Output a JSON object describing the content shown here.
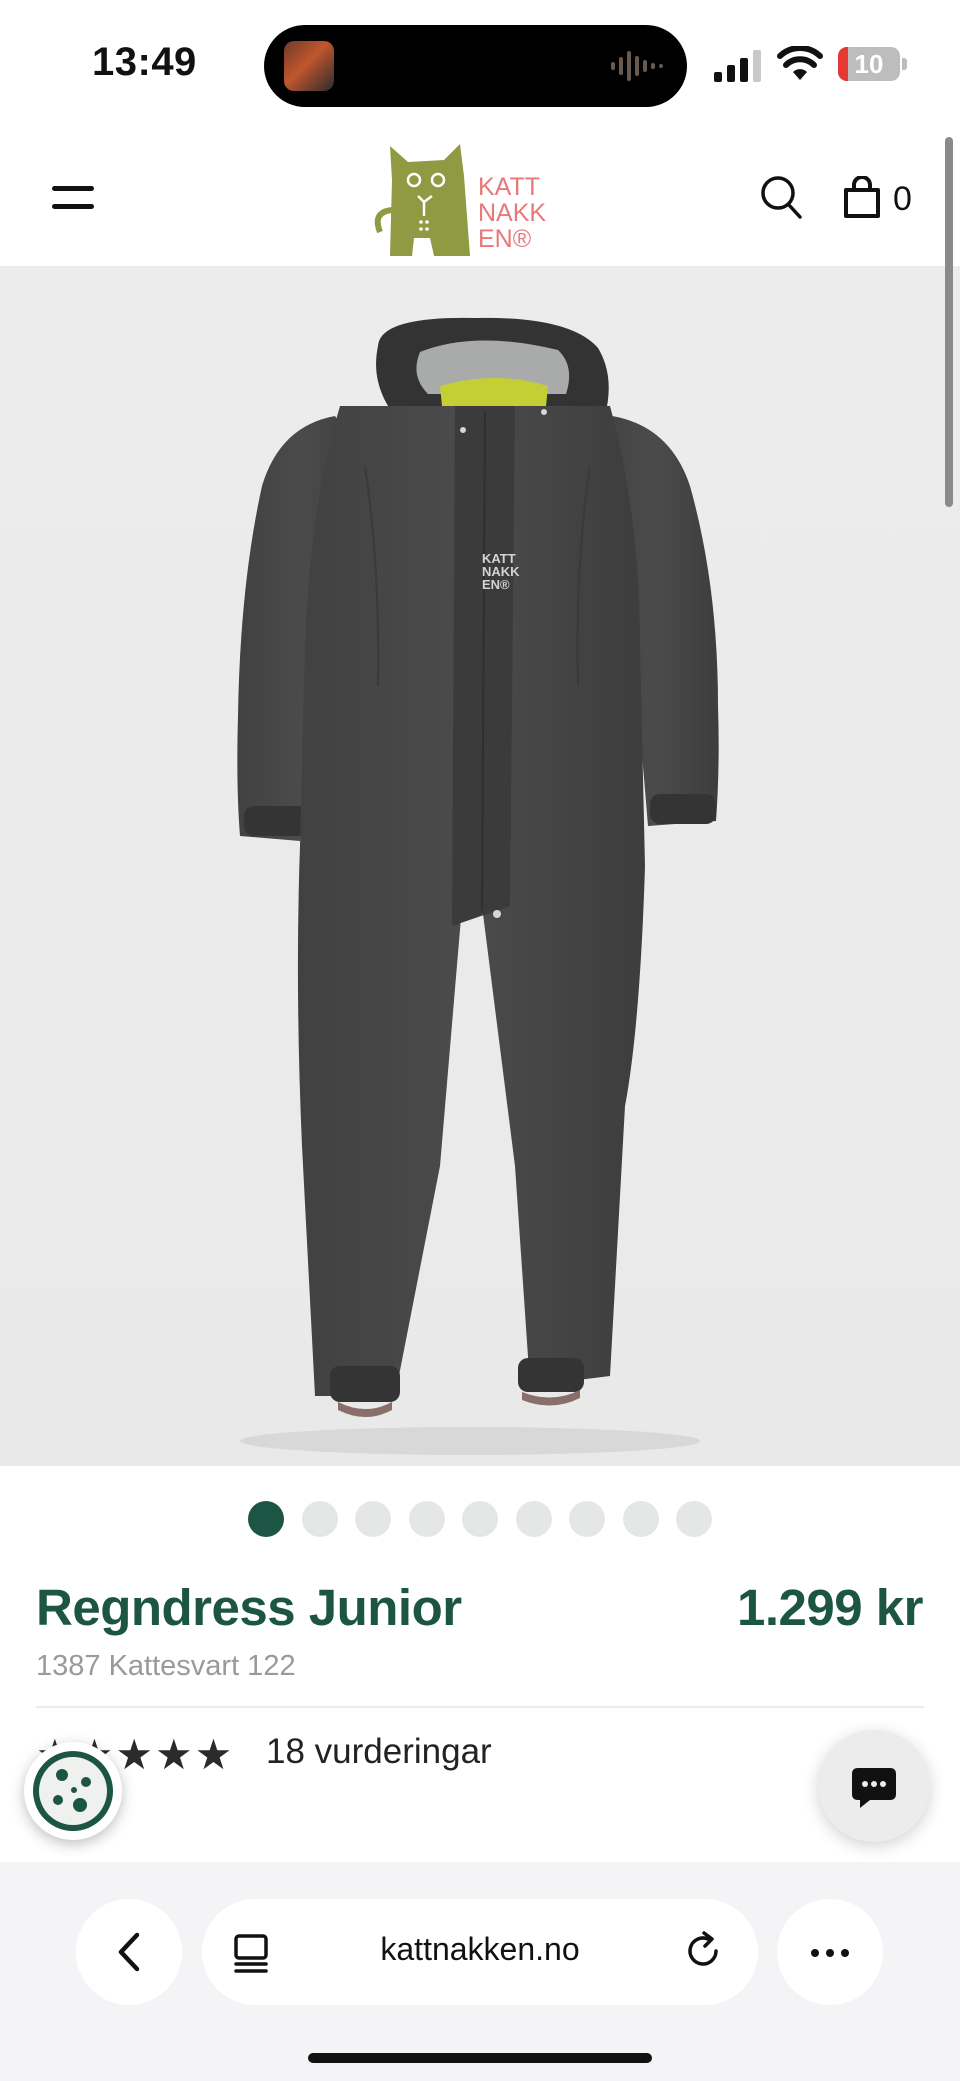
{
  "status_bar": {
    "time": "13:49",
    "battery_level": "10",
    "icons": [
      "now-playing-artwork",
      "audio-waveform-icon",
      "cellular-signal-icon",
      "wifi-icon",
      "battery-icon"
    ]
  },
  "header": {
    "logo_text": [
      "KATT",
      "NAKK",
      "EN®"
    ],
    "cart_count": "0",
    "icons": [
      "hamburger-menu-icon",
      "search-icon",
      "shopping-bag-icon"
    ],
    "logo_colors": {
      "cat": "#8f9a43",
      "text": "#e8787a"
    }
  },
  "product": {
    "image_alt": "Dark grey rain suit with hood",
    "jacket_label": [
      "KATT",
      "NAKK",
      "EN®"
    ],
    "title": "Regndress Junior",
    "price": "1.299 kr",
    "sku": "1387 Kattesvart 122",
    "rating_stars": 5,
    "rating_text": "18 vurderingar",
    "image_count": 9,
    "active_image": 1,
    "accent_color": "#1d5545"
  },
  "floating": {
    "icons": [
      "cookie-icon",
      "chat-bubble-icon"
    ]
  },
  "browser": {
    "url": "kattnakken.no",
    "icons": [
      "back-chevron-icon",
      "tabs-icon",
      "reload-icon",
      "more-dots-icon"
    ]
  }
}
